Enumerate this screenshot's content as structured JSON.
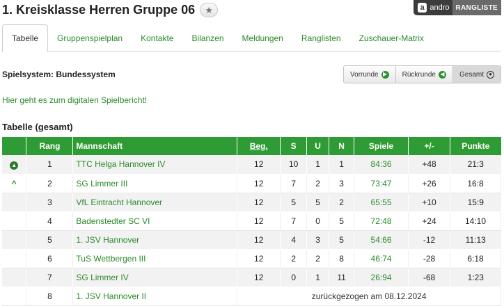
{
  "header": {
    "title": "1. Kreisklasse Herren Gruppe 06",
    "star_icon": "star-icon",
    "badge_logo": "a",
    "badge_brand": "andro",
    "badge_label": "RANGLISTE"
  },
  "tabs": [
    {
      "label": "Tabelle",
      "active": true
    },
    {
      "label": "Gruppenspielplan"
    },
    {
      "label": "Kontakte"
    },
    {
      "label": "Bilanzen"
    },
    {
      "label": "Meldungen"
    },
    {
      "label": "Ranglisten"
    },
    {
      "label": "Zuschauer-Matrix"
    }
  ],
  "system": {
    "label": "Spielsystem: Bundessystem",
    "buttons": [
      {
        "label": "Vorrunde",
        "icon": "arrow-right-circle-icon"
      },
      {
        "label": "Rückrunde",
        "icon": "arrow-left-circle-icon"
      },
      {
        "label": "Gesamt",
        "icon": "dot-circle-icon",
        "active": true
      }
    ]
  },
  "report_link": "Hier geht es zum digitalen Spielbericht!",
  "table": {
    "title": "Tabelle (gesamt)",
    "headers": {
      "status": "",
      "rang": "Rang",
      "team": "Mannschaft",
      "beg": "Beg.",
      "s": "S",
      "u": "U",
      "n": "N",
      "spiele": "Spiele",
      "diff": "+/-",
      "punkte": "Punkte"
    },
    "rows": [
      {
        "status": "up-circle",
        "rang": "1",
        "team": "TTC Helga Hannover IV",
        "beg": "12",
        "s": "10",
        "u": "1",
        "n": "1",
        "spiele": "84:36",
        "diff": "+48",
        "punkte": "21:3"
      },
      {
        "status": "up-arrow",
        "rang": "2",
        "team": "SG Limmer III",
        "beg": "12",
        "s": "7",
        "u": "2",
        "n": "3",
        "spiele": "73:47",
        "diff": "+26",
        "punkte": "16:8"
      },
      {
        "status": "",
        "rang": "3",
        "team": "VfL Eintracht Hannover",
        "beg": "12",
        "s": "5",
        "u": "5",
        "n": "2",
        "spiele": "65:55",
        "diff": "+10",
        "punkte": "15:9"
      },
      {
        "status": "",
        "rang": "4",
        "team": "Badenstedter SC VI",
        "beg": "12",
        "s": "7",
        "u": "0",
        "n": "5",
        "spiele": "72:48",
        "diff": "+24",
        "punkte": "14:10"
      },
      {
        "status": "",
        "rang": "5",
        "team": "1. JSV Hannover",
        "beg": "12",
        "s": "4",
        "u": "3",
        "n": "5",
        "spiele": "54:66",
        "diff": "-12",
        "punkte": "11:13"
      },
      {
        "status": "",
        "rang": "6",
        "team": "TuS Wettbergen III",
        "beg": "12",
        "s": "2",
        "u": "2",
        "n": "8",
        "spiele": "46:74",
        "diff": "-28",
        "punkte": "6:18"
      },
      {
        "status": "",
        "rang": "7",
        "team": "SG Limmer IV",
        "beg": "12",
        "s": "0",
        "u": "1",
        "n": "11",
        "spiele": "26:94",
        "diff": "-68",
        "punkte": "1:23"
      }
    ],
    "withdrawn_row": {
      "rang": "8",
      "team": "1. JSV Hannover II",
      "note": "zurückgezogen am 08.12.2024"
    }
  },
  "colors": {
    "accent_green": "#2e9b35",
    "link_green": "#2b8a2b"
  }
}
